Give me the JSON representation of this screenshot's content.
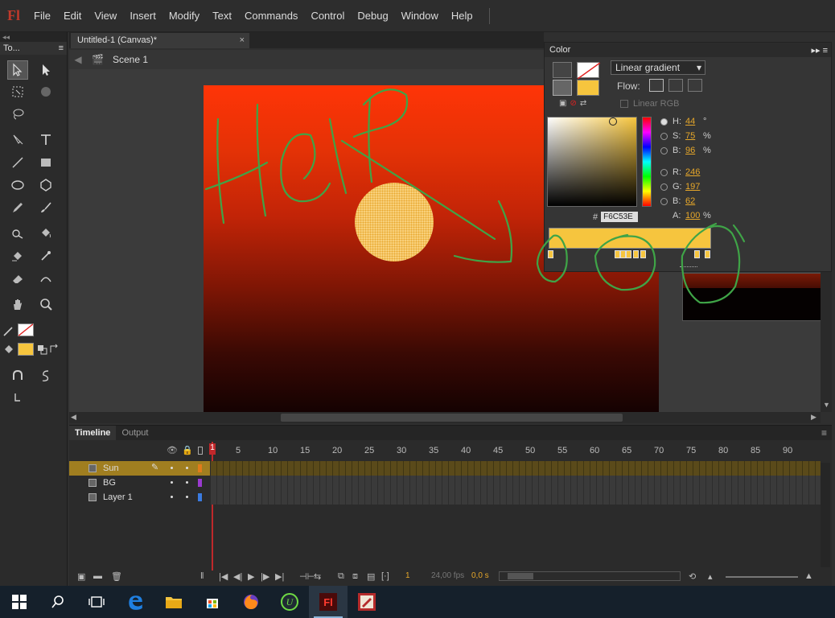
{
  "app": {
    "logo": "Fl"
  },
  "menu": [
    "File",
    "Edit",
    "View",
    "Insert",
    "Modify",
    "Text",
    "Commands",
    "Control",
    "Debug",
    "Window",
    "Help"
  ],
  "tools_panel": {
    "title": "To...",
    "collapse": "◂◂"
  },
  "doc_tab": {
    "label": "Untitled-1 (Canvas)*",
    "close": "×"
  },
  "scene": {
    "label": "Scene 1"
  },
  "color_panel": {
    "title": "Color",
    "mode": "Linear gradient",
    "flow_label": "Flow:",
    "linear_rgb": "Linear RGB",
    "hsb": [
      {
        "label": "H:",
        "value": "44",
        "unit": "°"
      },
      {
        "label": "S:",
        "value": "75",
        "unit": "%"
      },
      {
        "label": "B:",
        "value": "96",
        "unit": "%"
      }
    ],
    "rgb": [
      {
        "label": "R:",
        "value": "246"
      },
      {
        "label": "G:",
        "value": "197"
      },
      {
        "label": "B:",
        "value": "62"
      }
    ],
    "alpha": {
      "label": "A:",
      "value": "100",
      "unit": "%"
    },
    "hex_label": "#",
    "hex": "F6C53E",
    "color": "#f6c53e"
  },
  "timeline": {
    "tabs": [
      "Timeline",
      "Output"
    ],
    "ruler": [
      "1",
      "5",
      "10",
      "15",
      "20",
      "25",
      "30",
      "35",
      "40",
      "45",
      "50",
      "55",
      "60",
      "65",
      "70",
      "75",
      "80",
      "85",
      "90"
    ],
    "layers": [
      {
        "name": "Sun",
        "color": "#e07b1a"
      },
      {
        "name": "BG",
        "color": "#9b3ad0"
      },
      {
        "name": "Layer 1",
        "color": "#3a7be0"
      }
    ],
    "current_frame": "1",
    "fps": "24,00 fps",
    "time": "0,0 s"
  },
  "annotation": {
    "text": "Help"
  }
}
